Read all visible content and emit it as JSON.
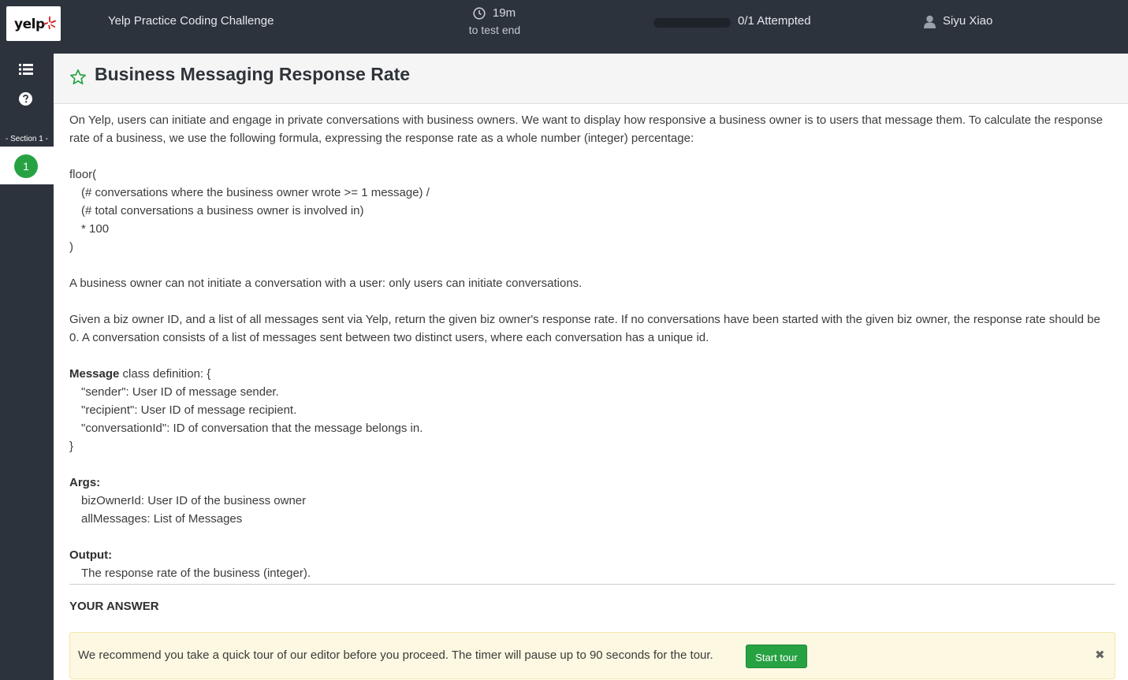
{
  "header": {
    "logo_text": "yelp",
    "app_title": "Yelp Practice Coding Challenge",
    "timer": {
      "value": "19m",
      "label": "to test end"
    },
    "progress": {
      "attempted": 0,
      "total": 1,
      "fraction": 0.0,
      "label": "0/1 Attempted"
    },
    "user_name": "Siyu Xiao"
  },
  "sidebar": {
    "section_label": "- Section 1 -",
    "questions": [
      "1"
    ],
    "icons": [
      "list-icon",
      "help-icon"
    ]
  },
  "question": {
    "title": "Business Messaging Response Rate",
    "intro": "On Yelp, users can initiate and engage in private conversations with business owners. We want to display how responsive a business owner is to users that message them. To calculate the response rate of a business, we use the following formula, expressing the response rate as a whole number (integer) percentage:",
    "formula": {
      "open": "floor(",
      "line1": "(# conversations where the business owner wrote >= 1 message) /",
      "line2": "(# total conversations a business owner is involved in)",
      "line3": "* 100",
      "close": ")"
    },
    "rule": "A business owner can not initiate a conversation with a user: only users can initiate conversations.",
    "task": "Given a biz owner ID, and a list of all messages sent via Yelp, return the given biz owner's response rate. If no conversations have been started with the given biz owner, the response rate should be 0. A conversation consists of a list of messages sent between two distinct users, where each conversation has a unique id.",
    "message_class": {
      "name": "Message",
      "header_rest": " class definition: {",
      "fields": [
        "\"sender\": User ID of message sender.",
        "\"recipient\": User ID of message recipient.",
        "\"conversationId\": ID of conversation that the message belongs in."
      ],
      "close": "}"
    },
    "args": {
      "label": "Args:",
      "items": [
        "bizOwnerId: User ID of the business owner",
        "allMessages: List of Messages"
      ]
    },
    "output": {
      "label": "Output:",
      "text": "The response rate of the business (integer)."
    }
  },
  "answer": {
    "title": "YOUR ANSWER",
    "tour_text": "We recommend you take a quick tour of our editor before you proceed. The timer will pause up to 90 seconds for the tour.",
    "tour_button": "Start tour",
    "close_symbol": "✖"
  },
  "colors": {
    "topbar": "#2c333d",
    "accent_green": "#27a243",
    "banner_bg": "#fcf8e1"
  }
}
